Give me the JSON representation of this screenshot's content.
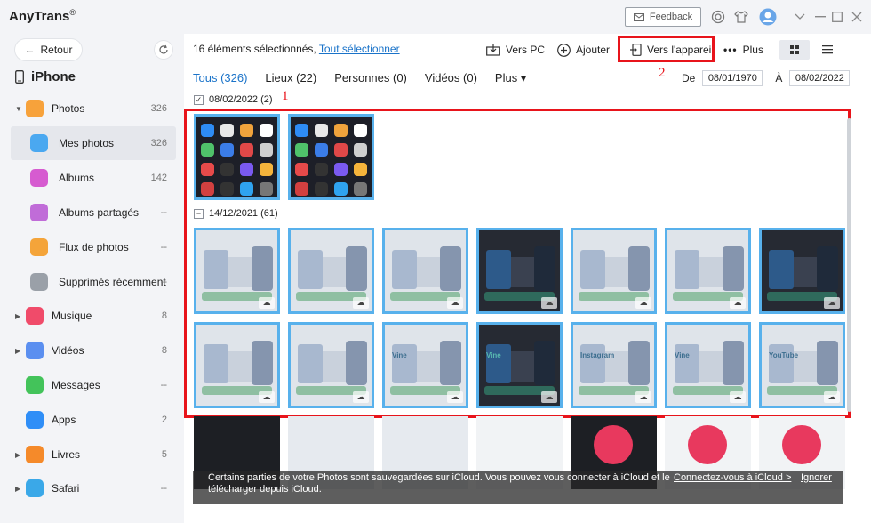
{
  "app": {
    "title": "AnyTrans",
    "reg": "®"
  },
  "titlebar": {
    "feedback_label": "Feedback"
  },
  "sidebar": {
    "back_label": "Retour",
    "device_name": "iPhone",
    "items": [
      {
        "label": "Photos",
        "count": "326",
        "expandable": true,
        "color": "#f7a23b"
      },
      {
        "label": "Mes photos",
        "count": "326",
        "active": true,
        "color": "#4aa8f0"
      },
      {
        "label": "Albums",
        "count": "142",
        "color": "#d65bd0"
      },
      {
        "label": "Albums partagés",
        "count": "--",
        "color": "#c06cd8"
      },
      {
        "label": "Flux de photos",
        "count": "--",
        "color": "#f4a43a"
      },
      {
        "label": "Supprimés récemment",
        "count": "--",
        "color": "#9aa0a8"
      },
      {
        "label": "Musique",
        "count": "8",
        "expandable": true,
        "color": "#f04b6a"
      },
      {
        "label": "Vidéos",
        "count": "8",
        "expandable": true,
        "color": "#5b8ff0"
      },
      {
        "label": "Messages",
        "count": "--",
        "color": "#43c35a"
      },
      {
        "label": "Apps",
        "count": "2",
        "color": "#2f8ef7"
      },
      {
        "label": "Livres",
        "count": "5",
        "expandable": true,
        "color": "#f58a2a"
      },
      {
        "label": "Safari",
        "count": "--",
        "expandable": true,
        "color": "#3aa8e8"
      }
    ]
  },
  "toolbar": {
    "selection_text": "16 éléments sélectionnés,",
    "select_all_label": "Tout sélectionner",
    "to_pc_label": "Vers PC",
    "add_label": "Ajouter",
    "to_device_label": "Vers l'appareil",
    "more_label": "Plus"
  },
  "tabs": [
    {
      "label": "Tous (326)",
      "active": true
    },
    {
      "label": "Lieux (22)"
    },
    {
      "label": "Personnes (0)"
    },
    {
      "label": "Vidéos (0)"
    },
    {
      "label": "Plus ▾"
    }
  ],
  "date_filter": {
    "from_label": "De",
    "from_value": "08/01/1970",
    "to_label": "À",
    "to_value": "08/02/2022"
  },
  "annotations": {
    "one": "1",
    "two": "2"
  },
  "groups": [
    {
      "date": "08/02/2022 (2)",
      "check": "✓"
    },
    {
      "date": "14/12/2021 (61)",
      "check": "−"
    }
  ],
  "thumb_text": {
    "vine": "Vine",
    "instagram": "Instagram",
    "youtube": "YouTube"
  },
  "banner": {
    "text_line1": "Certains parties de votre Photos sont sauvegardées sur iCloud. Vous pouvez vous connecter à iCloud et les",
    "text_line2": "télécharger depuis iCloud.",
    "connect_label": "Connectez-vous à iCloud >",
    "ignore_label": "Ignorer"
  },
  "colors": {
    "accent": "#1a73c9",
    "highlight_red": "#e8141b",
    "selection_blue": "#58b1ec"
  }
}
